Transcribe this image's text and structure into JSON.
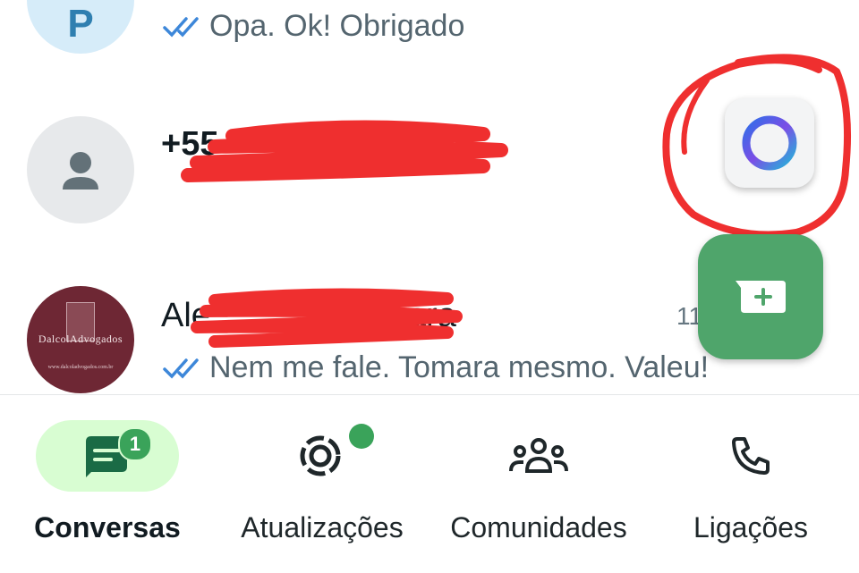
{
  "chats": [
    {
      "avatar_letter": "P",
      "preview": "Opa. Ok! Obrigado"
    },
    {
      "name": "+55",
      "preview": ""
    },
    {
      "name": "Ale",
      "name_tail": "ara",
      "time": "11",
      "preview": "Nem me fale. Tomara mesmo. Valeu!",
      "avatar_text": "DalcolAdvogados",
      "avatar_small": "www.dalcoladvogados.com.br"
    }
  ],
  "nav": {
    "chats": {
      "label": "Conversas",
      "badge": "1"
    },
    "updates": {
      "label": "Atualizações"
    },
    "communities": {
      "label": "Comunidades"
    },
    "calls": {
      "label": "Ligações"
    }
  },
  "colors": {
    "accent": "#3aa35a",
    "fab": "#4fa56b",
    "read_tick": "#3d87d9",
    "annotation": "#ef2f2f"
  }
}
